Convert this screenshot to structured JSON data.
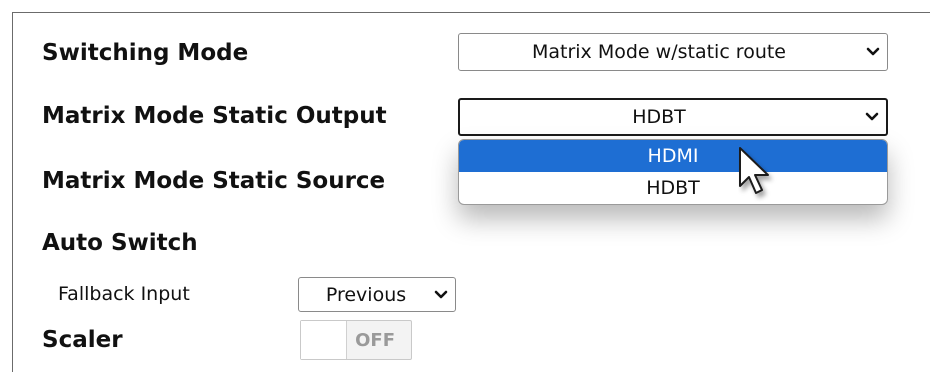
{
  "rows": {
    "switching_mode": {
      "label": "Switching Mode",
      "value": "Matrix Mode w/static route"
    },
    "static_output": {
      "label": "Matrix Mode Static Output",
      "value": "HDBT"
    },
    "static_source": {
      "label": "Matrix Mode Static Source"
    },
    "auto_switch": {
      "label": "Auto Switch"
    },
    "fallback_input": {
      "label": "Fallback Input",
      "value": "Previous"
    },
    "scaler": {
      "label": "Scaler",
      "toggle_state": "OFF"
    }
  },
  "dropdown": {
    "options": [
      "HDMI",
      "HDBT"
    ],
    "highlighted": "HDMI"
  },
  "icons": {
    "chevron": "chevron-down-icon",
    "cursor": "mouse-pointer-icon"
  },
  "colors": {
    "highlight": "#1e6ed3",
    "toggle_off_text": "#9a9a9a"
  }
}
